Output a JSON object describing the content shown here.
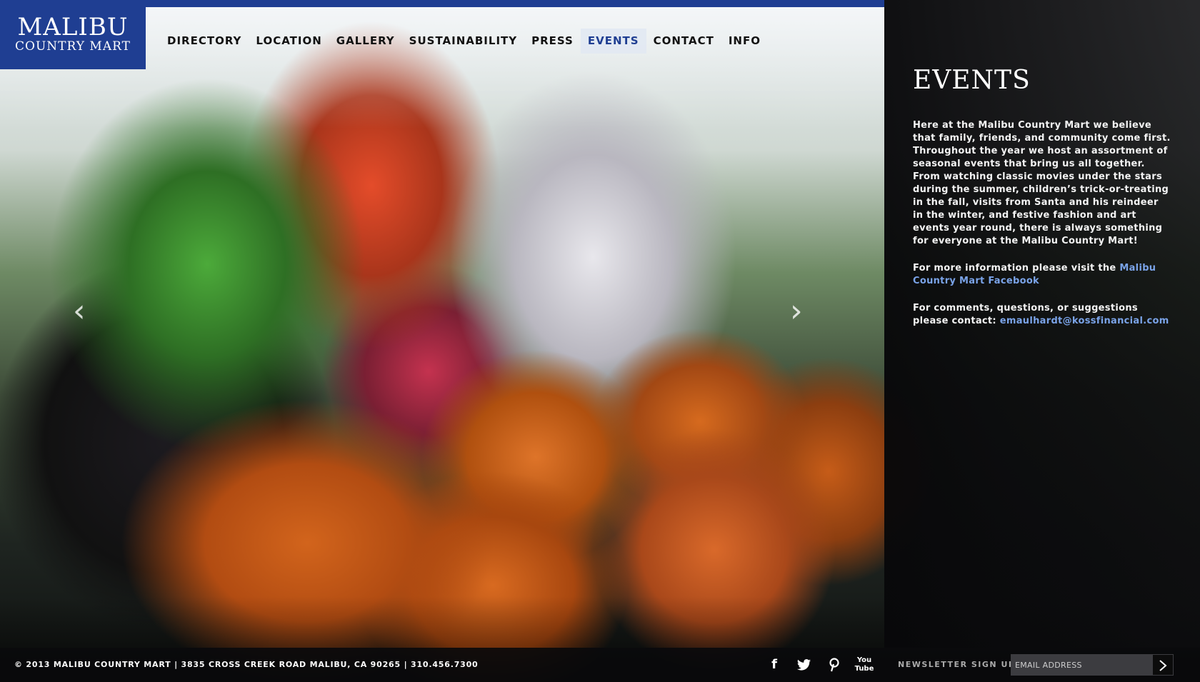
{
  "logo": {
    "line1": "MALIBU",
    "line2": "COUNTRY MART"
  },
  "nav": {
    "items": [
      {
        "label": "DIRECTORY"
      },
      {
        "label": "LOCATION"
      },
      {
        "label": "GALLERY"
      },
      {
        "label": "SUSTAINABILITY"
      },
      {
        "label": "PRESS"
      },
      {
        "label": "EVENTS"
      },
      {
        "label": "CONTACT"
      },
      {
        "label": "INFO"
      }
    ],
    "active": "EVENTS"
  },
  "slider": {
    "prev_icon": "chevron-left-icon",
    "next_icon": "chevron-right-icon"
  },
  "panel": {
    "title": "EVENTS",
    "intro": "Here at the Malibu Country Mart we believe that family, friends, and community come first. Throughout the year we host an assortment of seasonal events that bring us all together. From watching classic movies under the stars during the summer, children’s trick-or-treating in the fall, visits from Santa and his reindeer in the winter, and festive fashion and art events year round, there is always something for everyone at the Malibu Country Mart!",
    "more_info_prefix": "For more information please visit the ",
    "more_info_link": "Malibu Country Mart Facebook",
    "contact_prefix": "For comments, questions, or suggestions please contact: ",
    "contact_email": "emaulhardt@kossfinancial.com"
  },
  "footer": {
    "copyright": "© 2013 MALIBU COUNTRY MART | 3835 CROSS CREEK ROAD MALIBU, CA 90265 | 310.456.7300",
    "social": [
      "facebook-icon",
      "twitter-icon",
      "pinterest-icon",
      "youtube-icon"
    ],
    "youtube_label": "You Tube",
    "newsletter_label": "NEWSLETTER SIGN UP:",
    "email_placeholder": "EMAIL ADDRESS"
  },
  "colors": {
    "brand_blue": "#1f3e92",
    "link_blue": "#7aa3e8"
  }
}
